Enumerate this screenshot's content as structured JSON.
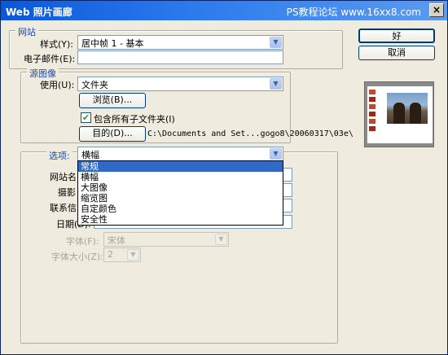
{
  "window": {
    "title": "Web 照片画廊",
    "watermark": "PS教程论坛 www.16xx8.com",
    "close_glyph": "×"
  },
  "site": {
    "legend": "网站",
    "style_label": "样式(Y):",
    "style_value": "居中帧 1 - 基本",
    "email_label": "电子邮件(E):",
    "email_value": ""
  },
  "source": {
    "legend": "源图像",
    "use_label": "使用(U):",
    "use_value": "文件夹",
    "browse_label": "浏览(B)...",
    "include_subfolders_label": "包含所有子文件夹(I)",
    "include_subfolders_checked": true,
    "destination_label": "目的(D)...",
    "destination_path": "C:\\Documents and Set...gogo8\\20060317\\03e\\"
  },
  "options": {
    "legend": "选项:",
    "selected_value": "横幅",
    "dropdown_items": [
      "常规",
      "横幅",
      "大图像",
      "缩览图",
      "自定颜色",
      "安全性"
    ],
    "selected_index": 0,
    "site_name_label": "网站名",
    "photographer_label": "摄影",
    "contact_label": "联系信",
    "date_label": "日期(D):",
    "font_label": "字体(F):",
    "font_value": "宋体",
    "font_size_label": "字体大小(Z):",
    "font_size_value": "2"
  },
  "buttons": {
    "ok_label": "好",
    "cancel_label": "取消"
  },
  "icons": {
    "dropdown_arrow": "▼",
    "checkmark": "✔"
  }
}
